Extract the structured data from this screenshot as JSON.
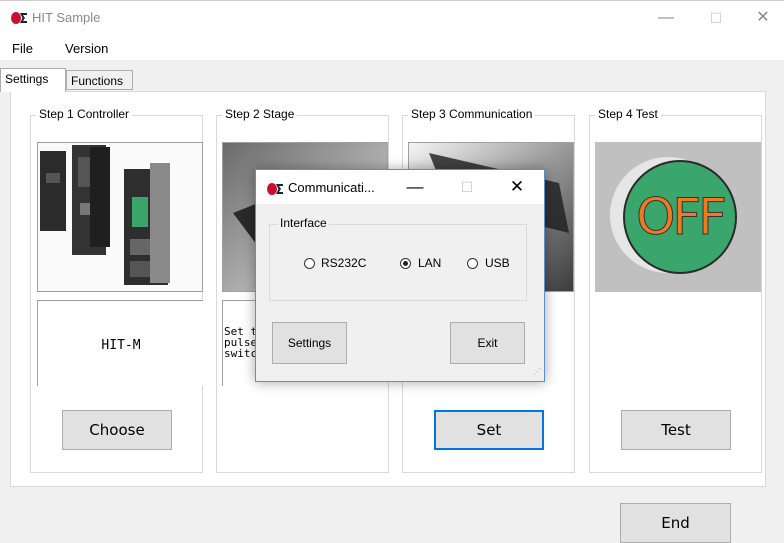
{
  "window": {
    "title": "HIT Sample",
    "minimize": "—",
    "maximize": "☐",
    "close": "✕"
  },
  "menu": {
    "file": "File",
    "version": "Version"
  },
  "tabs": [
    {
      "label": "Settings"
    },
    {
      "label": "Functions"
    }
  ],
  "steps": [
    {
      "label": "Step 1 Controller",
      "text": "HIT-M",
      "button": "Choose"
    },
    {
      "label": "Step 2 Stage",
      "text": "Set t\npulse\nswitc",
      "button": ""
    },
    {
      "label": "Step 3 Communication",
      "text": "",
      "button": "Set"
    },
    {
      "label": "Step 4 Test",
      "text": "",
      "button": "Test",
      "image_text": "OFF"
    }
  ],
  "end_button": "End",
  "dialog": {
    "title": "Communicati...",
    "minimize": "—",
    "maximize": "☐",
    "close": "✕",
    "interface_label": "Interface",
    "options": [
      {
        "label": "RS232C",
        "checked": false
      },
      {
        "label": "LAN",
        "checked": true
      },
      {
        "label": "USB",
        "checked": false
      }
    ],
    "settings_button": "Settings",
    "exit_button": "Exit"
  },
  "colors": {
    "accent": "#0078d7",
    "off_text": "#f07a20",
    "off_bg": "#3aa66b"
  }
}
